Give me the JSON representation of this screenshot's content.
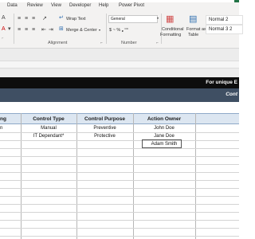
{
  "menu": [
    "Data",
    "Review",
    "View",
    "Developer",
    "Help",
    "Power Pivot"
  ],
  "ribbon": {
    "wrap_text": "Wrap Text",
    "merge_center": "Merge & Center",
    "number_format": "General",
    "number_buttons": "$ ~ % ❟ ⁰⁰",
    "conditional_formatting": [
      "Conditional",
      "Formatting"
    ],
    "format_as_table": [
      "Format as",
      "Table"
    ],
    "styles": [
      "Normal 2",
      "Normal 3 2"
    ],
    "group_alignment": "Alignment",
    "group_number": "Number"
  },
  "banner": {
    "top_text": "For unique E",
    "sub_text": "Cont"
  },
  "table": {
    "headers": {
      "partial": "ng",
      "control_type": "Control Type",
      "control_purpose": "Control Purpose",
      "action_owner": "Action Owner"
    },
    "rows": [
      {
        "partial": "n",
        "control_type": "Manual",
        "control_purpose": "Preventive",
        "action_owner": "John Doe"
      },
      {
        "partial": "",
        "control_type": "IT Dependant*",
        "control_purpose": "Protective",
        "action_owner": "Jane Doe"
      },
      {
        "partial": "",
        "control_type": "",
        "control_purpose": "",
        "action_owner": "Adam Smith"
      }
    ]
  }
}
